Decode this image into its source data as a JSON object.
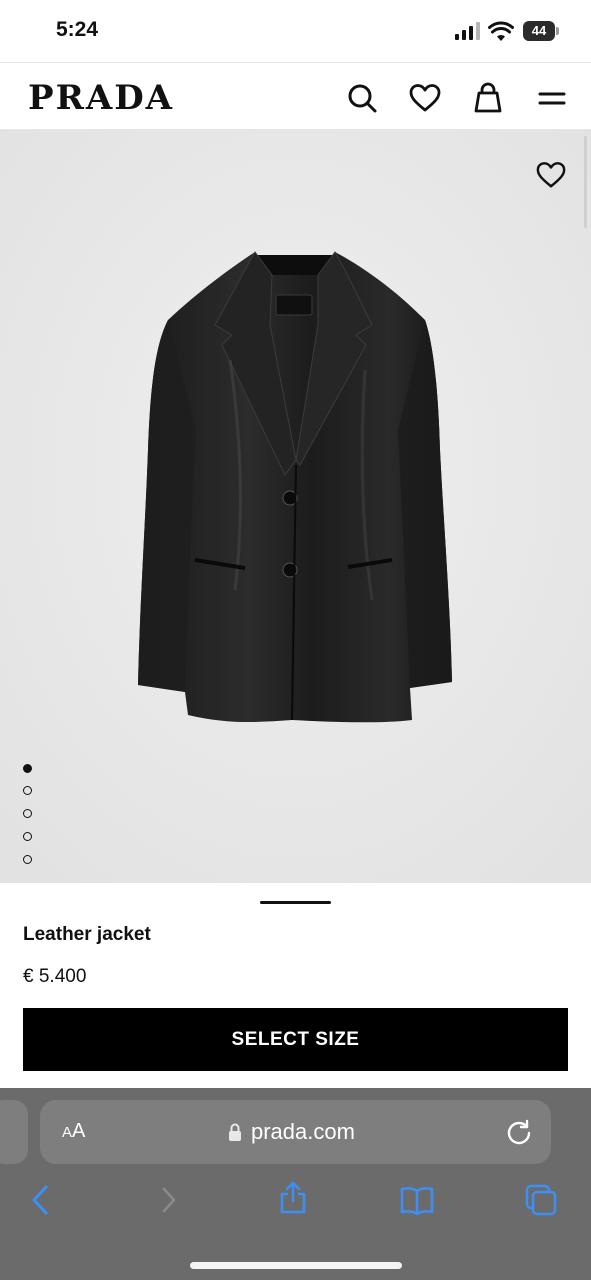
{
  "status_bar": {
    "time": "5:24",
    "battery": "44"
  },
  "header": {
    "logo": "PRADA",
    "icons": [
      "search-icon",
      "heart-icon",
      "bag-icon",
      "menu-icon"
    ]
  },
  "gallery": {
    "image_name": "black leather jacket",
    "total_images": 5,
    "active_index": 0,
    "wishlist_icon": "heart-icon"
  },
  "product": {
    "name": "Leather jacket",
    "price": "€ 5.400",
    "select_size_label": "SELECT SIZE"
  },
  "browser": {
    "text_size_label_small": "A",
    "text_size_label_large": "A",
    "url": "prada.com",
    "toolbar_icons": [
      "back-icon",
      "forward-icon",
      "share-icon",
      "bookmarks-icon",
      "tabs-icon"
    ]
  },
  "colors": {
    "brand": "#000000",
    "image_bg": "#e8e8e8",
    "browser_bar": "#6b6b6b",
    "link_blue": "#3d8ff5"
  }
}
